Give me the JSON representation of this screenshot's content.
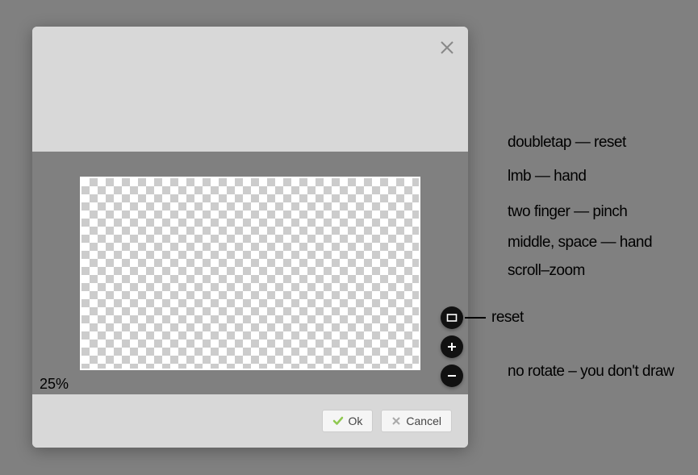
{
  "dialog": {
    "zoom_label": "25%",
    "ok_label": "Ok",
    "cancel_label": "Cancel"
  },
  "annotations": {
    "a1": "doubletap — reset",
    "a2": "lmb — hand",
    "a3": "two finger — pinch",
    "a4": "middle, space — hand",
    "a5": "scroll–zoom",
    "reset": "reset",
    "no_rotate": "no rotate – you don't draw"
  }
}
